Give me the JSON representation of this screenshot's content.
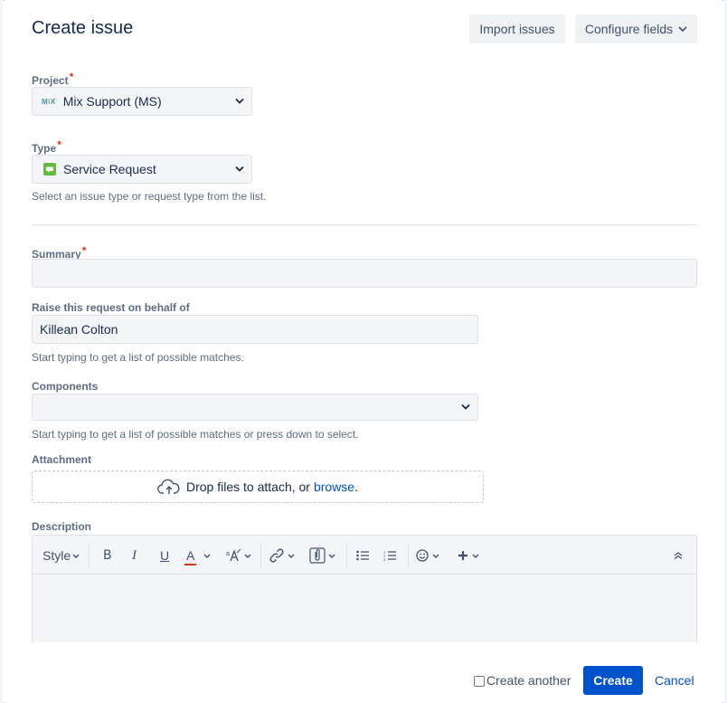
{
  "dialog": {
    "title": "Create issue",
    "import_label": "Import issues",
    "configure_label": "Configure fields"
  },
  "project": {
    "label": "Project",
    "required_mark": "*",
    "value": "Mix Support (MS)",
    "logo_text": "MIX"
  },
  "type": {
    "label": "Type",
    "required_mark": "*",
    "value": "Service Request",
    "help": "Select an issue type or request type from the list."
  },
  "summary": {
    "label": "Summary",
    "required_mark": "*",
    "value": ""
  },
  "behalf": {
    "label": "Raise this request on behalf of",
    "value": "Killean Colton",
    "help": "Start typing to get a list of possible matches."
  },
  "components": {
    "label": "Components",
    "value": "",
    "help": "Start typing to get a list of possible matches or press down to select."
  },
  "attachment": {
    "label": "Attachment",
    "drop_text": "Drop files to attach, or",
    "browse_link": "browse",
    "period": "."
  },
  "description": {
    "label": "Description",
    "style_label": "Style",
    "bold": "B",
    "italic": "I",
    "underline": "U",
    "text_color": "A"
  },
  "footer": {
    "create_another_label": "Create another",
    "create_label": "Create",
    "cancel_label": "Cancel"
  },
  "colors": {
    "primary": "#0052cc",
    "required": "#de350b",
    "text_color_underline": "#de350b",
    "type_icon": "#63ba3c"
  }
}
